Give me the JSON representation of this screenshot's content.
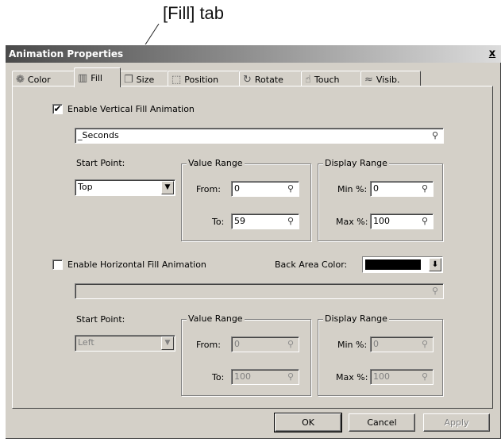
{
  "annotation": {
    "label": "[Fill] tab"
  },
  "window": {
    "title": "Animation Properties",
    "close_glyph": "x"
  },
  "tabs": [
    {
      "label": "Color",
      "icon": "color-wheel-icon",
      "glyph": "❁"
    },
    {
      "label": "Fill",
      "icon": "fill-icon",
      "glyph": "▥",
      "active": true
    },
    {
      "label": "Size",
      "icon": "size-icon",
      "glyph": "❐"
    },
    {
      "label": "Position",
      "icon": "position-icon",
      "glyph": "⬚"
    },
    {
      "label": "Rotate",
      "icon": "rotate-icon",
      "glyph": "↻"
    },
    {
      "label": "Touch",
      "icon": "hand-icon",
      "glyph": "☝"
    },
    {
      "label": "Visib.",
      "icon": "visibility-icon",
      "glyph": "≈"
    }
  ],
  "vertical": {
    "enable_label": "Enable Vertical Fill Animation",
    "checked_glyph": "✔",
    "tag_value": "_Seconds",
    "start_point_label": "Start Point:",
    "start_point_value": "Top",
    "value_range_title": "Value Range",
    "from_label": "From:",
    "from_value": "0",
    "to_label": "To:",
    "to_value": "59",
    "display_range_title": "Display Range",
    "min_label": "Min %:",
    "min_value": "0",
    "max_label": "Max %:",
    "max_value": "100"
  },
  "horizontal": {
    "enable_label": "Enable Horizontal Fill Animation",
    "tag_value": "",
    "back_area_label": "Back Area Color:",
    "back_area_color": "#000000",
    "start_point_label": "Start Point:",
    "start_point_value": "Left",
    "value_range_title": "Value Range",
    "from_label": "From:",
    "from_value": "0",
    "to_label": "To:",
    "to_value": "100",
    "display_range_title": "Display Range",
    "min_label": "Min %:",
    "min_value": "0",
    "max_label": "Max %:",
    "max_value": "100"
  },
  "icons": {
    "bulb": "⚲",
    "combo_arrow": "▼",
    "color_arrow": "⬇"
  },
  "buttons": {
    "ok": "OK",
    "cancel": "Cancel",
    "apply": "Apply"
  }
}
